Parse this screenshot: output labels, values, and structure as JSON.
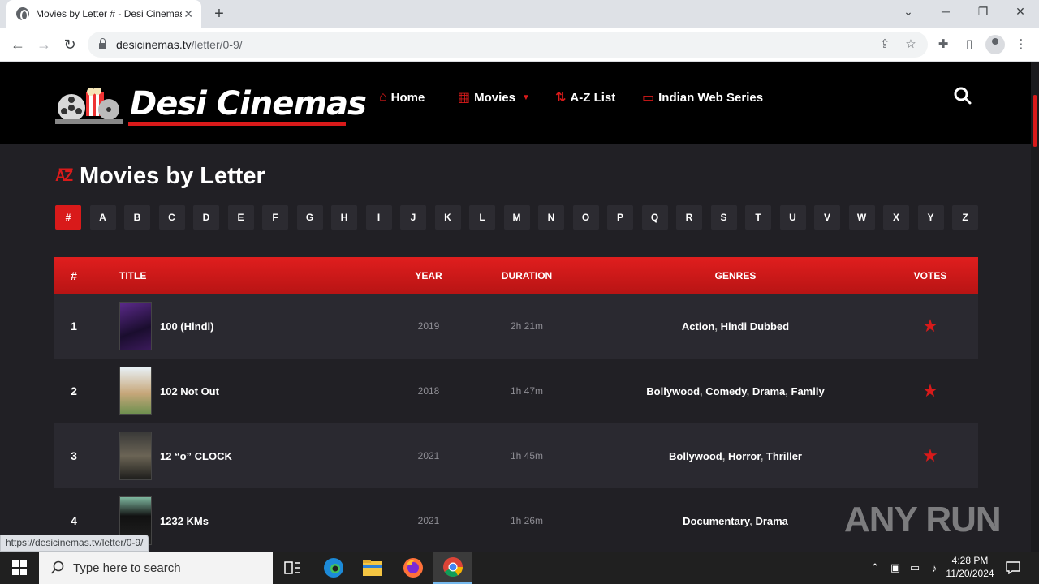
{
  "browser": {
    "tab_title": "Movies by Letter # - Desi Cinemas",
    "tab_close": "✕",
    "new_tab": "+",
    "url_host": "desicinemas.tv",
    "url_path": "/letter/0-9/",
    "status_url": "https://desicinemas.tv/letter/0-9/"
  },
  "site": {
    "brand": "Desi Cinemas",
    "nav": [
      {
        "label": "Home",
        "icon": "home-icon"
      },
      {
        "label": "Movies",
        "icon": "film-icon"
      },
      {
        "label": "A-Z List",
        "icon": "sort-az-icon"
      },
      {
        "label": "Indian Web Series",
        "icon": "tv-icon"
      }
    ],
    "page_title": "Movies by Letter",
    "letters": [
      "#",
      "A",
      "B",
      "C",
      "D",
      "E",
      "F",
      "G",
      "H",
      "I",
      "J",
      "K",
      "L",
      "M",
      "N",
      "O",
      "P",
      "Q",
      "R",
      "S",
      "T",
      "U",
      "V",
      "W",
      "X",
      "Y",
      "Z"
    ],
    "active_letter": "#",
    "table": {
      "headers": {
        "num": "#",
        "title": "TITLE",
        "year": "YEAR",
        "duration": "DURATION",
        "genres": "GENRES",
        "votes": "VOTES"
      },
      "rows": [
        {
          "num": "1",
          "title": "100 (Hindi)",
          "year": "2019",
          "duration": "2h 21m",
          "genres": [
            "Action",
            "Hindi Dubbed"
          ],
          "voted": true
        },
        {
          "num": "2",
          "title": "102 Not Out",
          "year": "2018",
          "duration": "1h 47m",
          "genres": [
            "Bollywood",
            "Comedy",
            "Drama",
            "Family"
          ],
          "voted": true
        },
        {
          "num": "3",
          "title": "12 “o” CLOCK",
          "year": "2021",
          "duration": "1h 45m",
          "genres": [
            "Bollywood",
            "Horror",
            "Thriller"
          ],
          "voted": true
        },
        {
          "num": "4",
          "title": "1232 KMs",
          "year": "2021",
          "duration": "1h 26m",
          "genres": [
            "Documentary",
            "Drama"
          ],
          "voted": false
        }
      ]
    },
    "accent_color": "#d91a1a"
  },
  "watermark": "ANY RUN",
  "taskbar": {
    "search_placeholder": "Type here to search",
    "time": "4:28 PM",
    "date": "11/20/2024"
  }
}
